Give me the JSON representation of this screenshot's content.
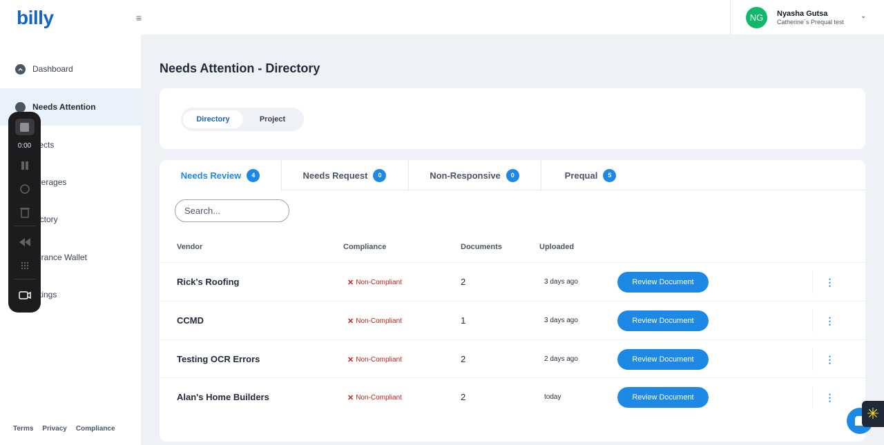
{
  "sidebar": {
    "logo": "billy",
    "menu_icon": "≡",
    "items": [
      {
        "label": "Dashboard",
        "icon": "dashboard-icon"
      },
      {
        "label": "Needs Attention",
        "icon": "alert-icon"
      },
      {
        "label": "ojects",
        "icon": "projects-icon"
      },
      {
        "label": "overages",
        "icon": "coverages-icon"
      },
      {
        "label": "rectory",
        "icon": "directory-icon"
      },
      {
        "label": "surance Wallet",
        "icon": "wallet-icon"
      },
      {
        "label": "ettings",
        "icon": "settings-icon"
      }
    ],
    "footer": [
      "Terms",
      "Privacy",
      "Compliance"
    ]
  },
  "recorder": {
    "time": "0:00"
  },
  "header": {
    "user_initials": "NG",
    "user_name": "Nyasha Gutsa",
    "user_org": "Catherine`s Prequal test",
    "avatar_color": "#12b76a"
  },
  "page": {
    "title": "Needs Attention - Directory"
  },
  "segmented": {
    "options": [
      "Directory",
      "Project"
    ],
    "selected": "Directory"
  },
  "tabs": [
    {
      "label": "Needs Review",
      "count": "4"
    },
    {
      "label": "Needs Request",
      "count": "0"
    },
    {
      "label": "Non-Responsive",
      "count": "0"
    },
    {
      "label": "Prequal",
      "count": "5"
    }
  ],
  "search": {
    "placeholder": "Search..."
  },
  "table": {
    "columns": [
      "Vendor",
      "Compliance",
      "Documents",
      "Uploaded"
    ],
    "rows": [
      {
        "vendor": "Rick's Roofing",
        "compliance": "Non-Compliant",
        "documents": "2",
        "uploaded": "3 days ago",
        "action": "Review Document"
      },
      {
        "vendor": "CCMD",
        "compliance": "Non-Compliant",
        "documents": "1",
        "uploaded": "3 days ago",
        "action": "Review Document"
      },
      {
        "vendor": "Testing OCR Errors",
        "compliance": "Non-Compliant",
        "documents": "2",
        "uploaded": "2 days ago",
        "action": "Review Document"
      },
      {
        "vendor": "Alan's Home Builders",
        "compliance": "Non-Compliant",
        "documents": "2",
        "uploaded": "today",
        "action": "Review Document"
      }
    ]
  },
  "colors": {
    "accent": "#1e88e5",
    "brand": "#1663c7",
    "error": "#b42318"
  }
}
